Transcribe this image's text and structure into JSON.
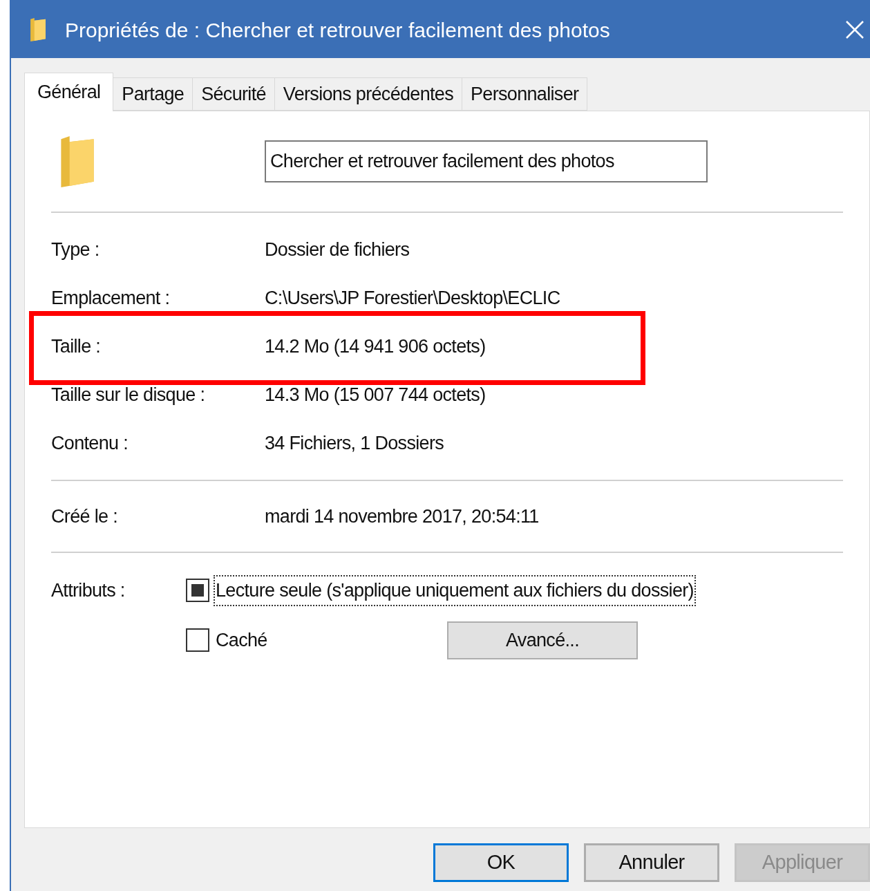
{
  "window": {
    "title": "Propriétés de : Chercher et retrouver facilement des photos"
  },
  "tabs": [
    {
      "label": "Général",
      "selected": true
    },
    {
      "label": "Partage",
      "selected": false
    },
    {
      "label": "Sécurité",
      "selected": false
    },
    {
      "label": "Versions précédentes",
      "selected": false
    },
    {
      "label": "Personnaliser",
      "selected": false
    }
  ],
  "name_field": {
    "value": "Chercher et retrouver facilement des photos"
  },
  "sections": [
    {
      "rows": [
        {
          "label": "Type :",
          "value": "Dossier de fichiers",
          "highlighted": false
        },
        {
          "label": "Emplacement :",
          "value": "C:\\Users\\JP Forestier\\Desktop\\ECLIC",
          "highlighted": false
        },
        {
          "label": "Taille :",
          "value": "14.2 Mo (14 941 906 octets)",
          "highlighted": true
        },
        {
          "label": "Taille sur le disque :",
          "value": "14.3 Mo (15 007 744 octets)",
          "highlighted": false
        },
        {
          "label": "Contenu :",
          "value": "34 Fichiers, 1 Dossiers",
          "highlighted": false
        }
      ]
    },
    {
      "rows": [
        {
          "label": "Créé le :",
          "value": "mardi 14 novembre 2017, 20:54:11",
          "highlighted": false
        }
      ]
    }
  ],
  "attributes": {
    "label": "Attributs :",
    "options": [
      {
        "label": "Lecture seule (s'applique uniquement aux fichiers du dossier)",
        "checked": true,
        "mixed": true,
        "focused": true
      },
      {
        "label": "Caché",
        "checked": false,
        "mixed": false,
        "focused": false
      }
    ],
    "advanced_button": "Avancé..."
  },
  "buttons": [
    {
      "label": "OK",
      "default": true,
      "disabled": false
    },
    {
      "label": "Annuler",
      "default": false,
      "disabled": false
    },
    {
      "label": "Appliquer",
      "default": false,
      "disabled": true
    }
  ]
}
